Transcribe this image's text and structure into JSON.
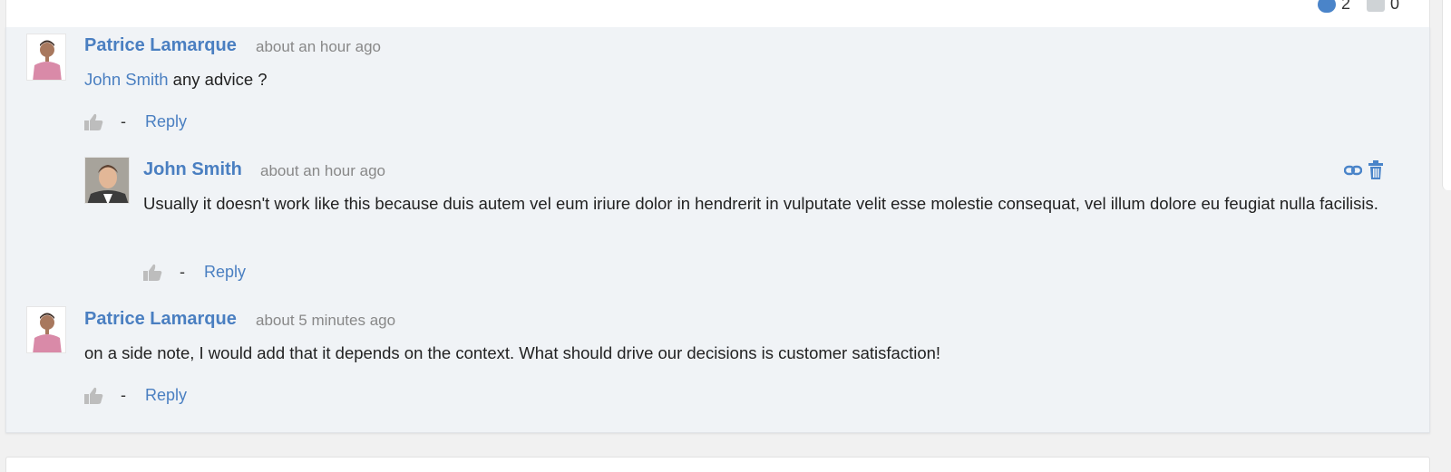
{
  "counters": {
    "likes_count": "2",
    "comments_count": "0"
  },
  "comments": [
    {
      "author": "Patrice Lamarque",
      "time": "about an hour ago",
      "mention": "John Smith",
      "text": " any advice ?",
      "reply_label": "Reply",
      "separator": "-"
    },
    {
      "author": "John Smith",
      "time": "about an hour ago",
      "text": "Usually it doesn't work like this because duis autem vel eum iriure dolor in hendrerit in vulputate velit esse molestie consequat, vel illum dolore eu feugiat nulla facilisis.",
      "reply_label": "Reply",
      "separator": "-"
    },
    {
      "author": "Patrice Lamarque",
      "time": "about 5 minutes ago",
      "text": "on a side note, I would add that it depends on the context. What should drive our decisions is customer satisfaction!",
      "reply_label": "Reply",
      "separator": "-"
    }
  ],
  "colors": {
    "link": "#4a7fc1",
    "card_bg": "#f0f3f6",
    "page_bg": "#f1f1f1",
    "thumb": "#bdbdbd"
  },
  "icons": [
    "like-counter-icon",
    "comment-counter-icon",
    "thumbs-up-icon",
    "link-icon",
    "trash-icon",
    "avatar"
  ]
}
